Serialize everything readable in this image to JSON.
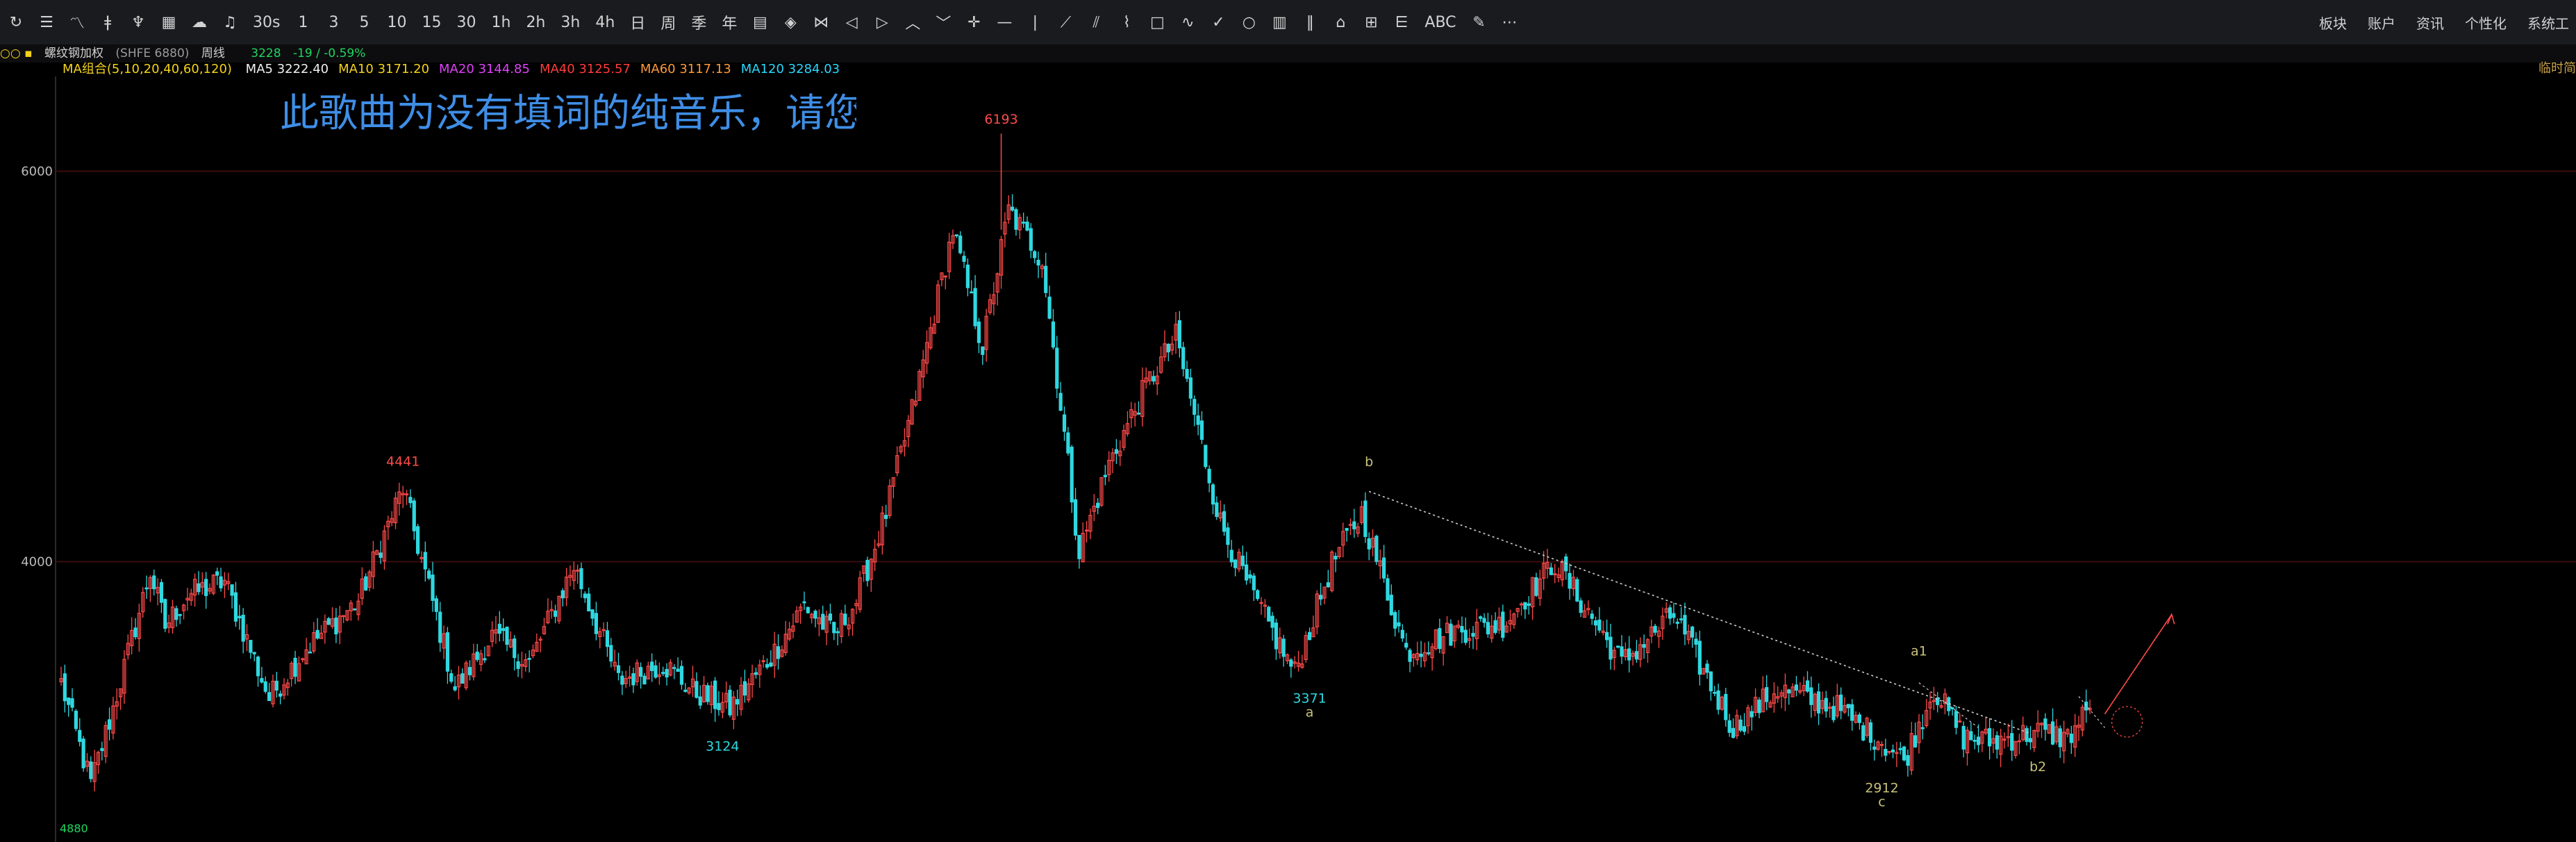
{
  "toolbar": {
    "tools": [
      {
        "icon": "refresh-icon",
        "label": ""
      },
      {
        "icon": "list-icon",
        "label": ""
      },
      {
        "icon": "line-chart-icon",
        "label": ""
      },
      {
        "icon": "candle-icon",
        "label": ""
      },
      {
        "icon": "pattern-icon",
        "label": ""
      },
      {
        "icon": "grid-icon",
        "label": ""
      },
      {
        "icon": "cloud-icon",
        "label": ""
      },
      {
        "icon": "bell-icon",
        "label": ""
      },
      {
        "icon": "",
        "label": "30s"
      },
      {
        "icon": "",
        "label": "1"
      },
      {
        "icon": "",
        "label": "3"
      },
      {
        "icon": "",
        "label": "5"
      },
      {
        "icon": "",
        "label": "10"
      },
      {
        "icon": "",
        "label": "15"
      },
      {
        "icon": "",
        "label": "30"
      },
      {
        "icon": "",
        "label": "1h"
      },
      {
        "icon": "",
        "label": "2h"
      },
      {
        "icon": "",
        "label": "3h"
      },
      {
        "icon": "",
        "label": "4h"
      },
      {
        "icon": "",
        "label": "日"
      },
      {
        "icon": "",
        "label": "周"
      },
      {
        "icon": "",
        "label": "季"
      },
      {
        "icon": "",
        "label": "年"
      },
      {
        "icon": "calendar-icon",
        "label": ""
      },
      {
        "icon": "eye-icon",
        "label": ""
      },
      {
        "icon": "expand-icon",
        "label": ""
      },
      {
        "icon": "arrow-left-icon",
        "label": ""
      },
      {
        "icon": "arrow-right-icon",
        "label": ""
      },
      {
        "icon": "chevron-up-icon",
        "label": ""
      },
      {
        "icon": "chevron-down-icon",
        "label": ""
      },
      {
        "icon": "crosshair-icon",
        "label": ""
      },
      {
        "icon": "hline-icon",
        "label": ""
      },
      {
        "icon": "vline-icon",
        "label": ""
      },
      {
        "icon": "trendline-icon",
        "label": ""
      },
      {
        "icon": "channel-icon",
        "label": ""
      },
      {
        "icon": "polyline-icon",
        "label": ""
      },
      {
        "icon": "rectangle-icon",
        "label": ""
      },
      {
        "icon": "wave-icon",
        "label": ""
      },
      {
        "icon": "check-icon",
        "label": ""
      },
      {
        "icon": "circle-icon",
        "label": ""
      },
      {
        "icon": "ruler-icon",
        "label": ""
      },
      {
        "icon": "bars-icon",
        "label": ""
      },
      {
        "icon": "home-icon",
        "label": ""
      },
      {
        "icon": "measure-icon",
        "label": ""
      },
      {
        "icon": "fib-icon",
        "label": ""
      },
      {
        "icon": "",
        "label": "ABC"
      },
      {
        "icon": "pen-icon",
        "label": ""
      },
      {
        "icon": "more-icon",
        "label": ""
      }
    ],
    "right_menu": [
      "板块",
      "账户",
      "资讯",
      "个性化",
      "系统工"
    ]
  },
  "info": {
    "prefix": "○○ ▪",
    "instrument": "螺纹钢加权",
    "code": "(SHFE 6880)",
    "period": "周线",
    "last": "3228",
    "change": "-19 / -0.59%"
  },
  "ma": {
    "group": "MA组合(5,10,20,40,60,120)",
    "items": [
      {
        "label": "MA5 3222.40",
        "color": "#f0f0f0"
      },
      {
        "label": "MA10 3171.20",
        "color": "#f2d21b"
      },
      {
        "label": "MA20 3144.85",
        "color": "#e040fb"
      },
      {
        "label": "MA40 3125.57",
        "color": "#ff3b3b"
      },
      {
        "label": "MA60 3117.13",
        "color": "#ff9a3c"
      },
      {
        "label": "MA120 3284.03",
        "color": "#29d8ff"
      }
    ]
  },
  "right_tag": "临时简",
  "overlay_text": "此歌曲为没有填词的纯音乐，请您",
  "bottom_stamp": "4880",
  "colors": {
    "up": "#ff4a4a",
    "down": "#2fd8e0",
    "grid": "#3a0e0e",
    "trend": "#cfcfcf"
  },
  "chart_data": {
    "type": "candlestick",
    "ylim": [
      2600,
      6450
    ],
    "yticks": [
      4000,
      6000
    ],
    "anchors": [
      {
        "i": 0,
        "v": 3380
      },
      {
        "i": 8,
        "v": 2860
      },
      {
        "i": 14,
        "v": 3250
      },
      {
        "i": 24,
        "v": 3950
      },
      {
        "i": 28,
        "v": 3670
      },
      {
        "i": 34,
        "v": 3830
      },
      {
        "i": 44,
        "v": 3900
      },
      {
        "i": 56,
        "v": 3300
      },
      {
        "i": 66,
        "v": 3560
      },
      {
        "i": 80,
        "v": 3800
      },
      {
        "i": 92,
        "v": 4380
      },
      {
        "i": 106,
        "v": 3350
      },
      {
        "i": 116,
        "v": 3620
      },
      {
        "i": 126,
        "v": 3480
      },
      {
        "i": 138,
        "v": 3980
      },
      {
        "i": 150,
        "v": 3390
      },
      {
        "i": 162,
        "v": 3480
      },
      {
        "i": 170,
        "v": 3340
      },
      {
        "i": 180,
        "v": 3250
      },
      {
        "i": 192,
        "v": 3540
      },
      {
        "i": 200,
        "v": 3780
      },
      {
        "i": 208,
        "v": 3620
      },
      {
        "i": 214,
        "v": 3800
      },
      {
        "i": 222,
        "v": 4250
      },
      {
        "i": 230,
        "v": 4850
      },
      {
        "i": 240,
        "v": 5700
      },
      {
        "i": 248,
        "v": 5100
      },
      {
        "i": 255,
        "v": 5800
      },
      {
        "i": 264,
        "v": 5550
      },
      {
        "i": 274,
        "v": 4050
      },
      {
        "i": 282,
        "v": 4500
      },
      {
        "i": 292,
        "v": 4900
      },
      {
        "i": 300,
        "v": 5150
      },
      {
        "i": 312,
        "v": 4200
      },
      {
        "i": 320,
        "v": 3850
      },
      {
        "i": 332,
        "v": 3430
      },
      {
        "i": 342,
        "v": 3990
      },
      {
        "i": 350,
        "v": 4250
      },
      {
        "i": 362,
        "v": 3540
      },
      {
        "i": 376,
        "v": 3650
      },
      {
        "i": 388,
        "v": 3680
      },
      {
        "i": 402,
        "v": 4000
      },
      {
        "i": 420,
        "v": 3480
      },
      {
        "i": 434,
        "v": 3730
      },
      {
        "i": 450,
        "v": 3150
      },
      {
        "i": 462,
        "v": 3350
      },
      {
        "i": 478,
        "v": 3250
      },
      {
        "i": 490,
        "v": 3080
      },
      {
        "i": 496,
        "v": 2980
      },
      {
        "i": 504,
        "v": 3350
      },
      {
        "i": 512,
        "v": 3100
      },
      {
        "i": 520,
        "v": 3080
      },
      {
        "i": 532,
        "v": 3130
      },
      {
        "i": 540,
        "v": 3100
      },
      {
        "i": 546,
        "v": 3250
      }
    ],
    "labels": [
      {
        "text": "6193",
        "i": 253,
        "v": 6193,
        "color": "#ff4a4a",
        "pos": "above"
      },
      {
        "text": "4441",
        "i": 92,
        "v": 4441,
        "color": "#ff4a4a",
        "pos": "above"
      },
      {
        "text": "3124",
        "i": 178,
        "v": 3124,
        "color": "#2fd8e0",
        "pos": "below"
      },
      {
        "text": "3371",
        "i": 336,
        "v": 3371,
        "color": "#2fd8e0",
        "pos": "below"
      },
      {
        "text": "a",
        "i": 336,
        "v": 3300,
        "color": "#c9c27a",
        "pos": "below"
      },
      {
        "text": "b",
        "i": 352,
        "v": 4440,
        "color": "#c9c27a",
        "pos": "above"
      },
      {
        "text": "a1",
        "i": 500,
        "v": 3470,
        "color": "#c9c27a",
        "pos": "above"
      },
      {
        "text": "2912",
        "i": 490,
        "v": 2912,
        "color": "#c9c27a",
        "pos": "below"
      },
      {
        "text": "c",
        "i": 490,
        "v": 2840,
        "color": "#c9c27a",
        "pos": "below"
      },
      {
        "text": "b2",
        "i": 532,
        "v": 3020,
        "color": "#c9c27a",
        "pos": "below"
      }
    ]
  }
}
